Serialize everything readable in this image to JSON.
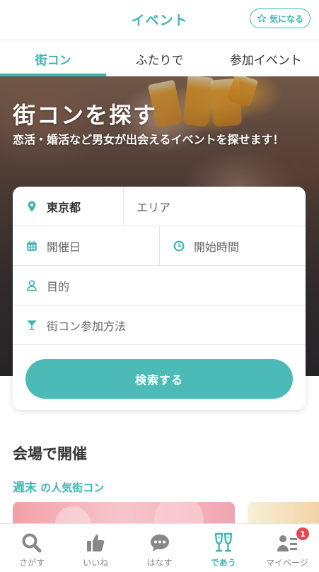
{
  "header": {
    "title": "イベント",
    "favorite_label": "気になる",
    "favorite_icon": "star-icon"
  },
  "tabs": [
    {
      "label": "街コン",
      "active": true
    },
    {
      "label": "ふたりで",
      "active": false
    },
    {
      "label": "参加イベント",
      "active": false
    }
  ],
  "hero": {
    "title": "街コンを探す",
    "subtitle": "恋活・婚活など男女が出会えるイベントを探せます！"
  },
  "search": {
    "prefecture": {
      "value": "東京都",
      "icon": "map-pin-icon"
    },
    "area": {
      "placeholder": "エリア"
    },
    "date": {
      "placeholder": "開催日",
      "icon": "calendar-icon"
    },
    "time": {
      "placeholder": "開始時間",
      "icon": "clock-icon"
    },
    "purpose": {
      "placeholder": "目的",
      "icon": "person-icon"
    },
    "method": {
      "placeholder": "街コン参加方法",
      "icon": "cocktail-icon"
    },
    "button_label": "検索する"
  },
  "section": {
    "title": "会場で開催",
    "sub_highlight": "週末",
    "sub_rest": " の人気街コン"
  },
  "bottom_nav": [
    {
      "label": "さがす",
      "icon": "search-icon",
      "active": false
    },
    {
      "label": "いいね",
      "icon": "thumbs-up-icon",
      "active": false
    },
    {
      "label": "はなす",
      "icon": "chat-bubble-icon",
      "active": false
    },
    {
      "label": "であう",
      "icon": "champagne-glasses-icon",
      "active": true
    },
    {
      "label": "マイページ",
      "icon": "user-list-icon",
      "active": false,
      "badge": "1"
    }
  ],
  "colors": {
    "accent": "#3db6b2",
    "button": "#4cbab6",
    "badge": "#e8474f"
  }
}
